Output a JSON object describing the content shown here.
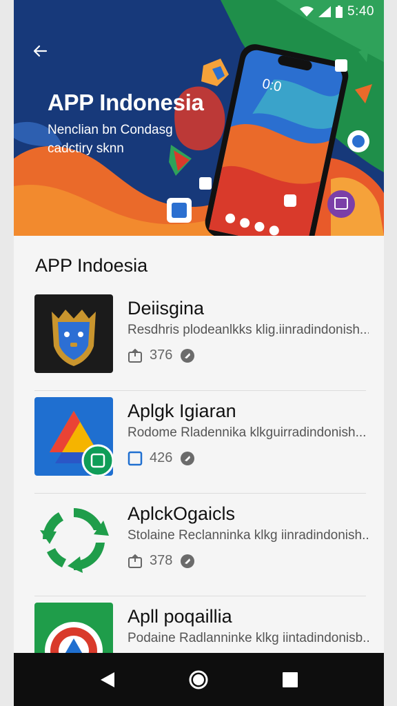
{
  "status_bar": {
    "time": "5:40",
    "icons": [
      "wifi-icon",
      "signal-icon",
      "battery-icon"
    ]
  },
  "hero": {
    "back_icon": "arrow-back-icon",
    "title": "APP Indonesia",
    "subtitle": "Nenclian bn Condasg cadctiry sknn",
    "phone_time": "0:0",
    "colors": {
      "navy": "#17397a",
      "green": "#1f8f4a",
      "orange": "#ea6a2a",
      "red": "#d93a2b"
    }
  },
  "section": {
    "title": "APP Indoesia"
  },
  "apps": [
    {
      "name": "Deiisgina",
      "desc": "Resdhris plodeanlkks klig.iinradindonish...",
      "count": "376",
      "meta_icon": "package-icon",
      "icon": "shield-mask-icon"
    },
    {
      "name": "Aplgk Igiaran",
      "desc": "Rodome Rladennika klkguirradindonish...",
      "count": "426",
      "meta_icon": "square-outline-icon",
      "icon": "drive-triangle-icon"
    },
    {
      "name": "AplckOgaicls",
      "desc": "Stolaine Reclanninka klkg iinradindonish...",
      "count": "378",
      "meta_icon": "package-icon",
      "icon": "recycle-arrows-icon"
    },
    {
      "name": "Apll poqaillia",
      "desc": "Podaine Radlanninke klkg iintadindonisb...",
      "count": "",
      "meta_icon": "",
      "icon": "drive-circle-icon"
    }
  ],
  "nav": {
    "back": "back-triangle-icon",
    "home": "home-circle-icon",
    "recents": "recents-square-icon"
  }
}
